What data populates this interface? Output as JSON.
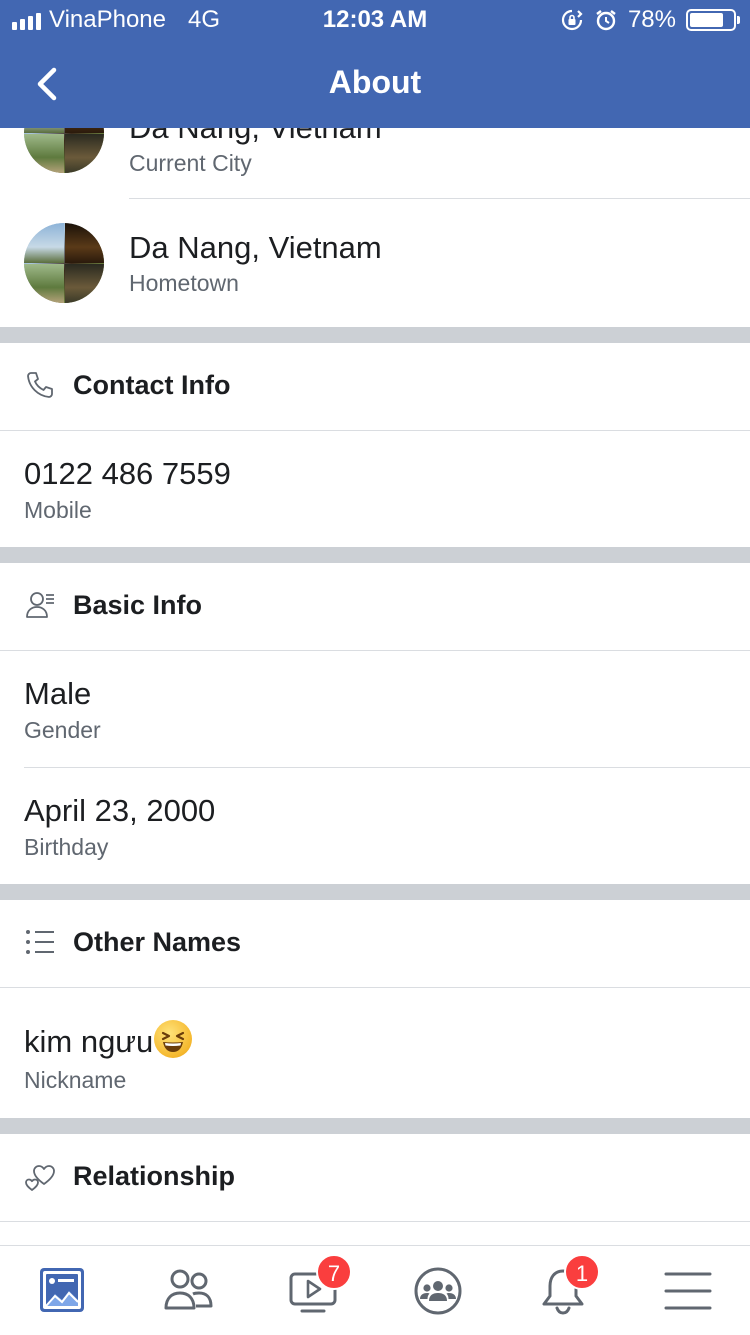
{
  "status_bar": {
    "carrier": "VinaPhone",
    "network": "4G",
    "time": "12:03 AM",
    "battery": "78%",
    "battery_level": 0.78
  },
  "nav": {
    "title": "About",
    "back_icon": "chevron-left-icon"
  },
  "places": [
    {
      "title": "Da Nang, Vietnam",
      "subtitle": "Current City"
    },
    {
      "title": "Da Nang, Vietnam",
      "subtitle": "Hometown"
    }
  ],
  "sections": {
    "contact": {
      "title": "Contact Info",
      "icon": "phone-icon",
      "rows": [
        {
          "value": "0122 486 7559",
          "label": "Mobile"
        }
      ]
    },
    "basic": {
      "title": "Basic Info",
      "icon": "person-list-icon",
      "rows": [
        {
          "value": "Male",
          "label": "Gender"
        },
        {
          "value": "April 23, 2000",
          "label": "Birthday"
        }
      ]
    },
    "other_names": {
      "title": "Other Names",
      "icon": "list-icon",
      "rows": [
        {
          "value": "kim ngưu",
          "label": "Nickname",
          "emoji": "grinning-squinting-face-icon"
        }
      ]
    },
    "relationship": {
      "title": "Relationship",
      "icon": "hearts-icon"
    }
  },
  "tabbar": {
    "items": [
      {
        "name": "news-feed",
        "icon": "news-feed-icon",
        "active": true
      },
      {
        "name": "friends",
        "icon": "friends-icon"
      },
      {
        "name": "watch",
        "icon": "watch-icon",
        "badge": "7"
      },
      {
        "name": "groups",
        "icon": "groups-icon"
      },
      {
        "name": "notifications",
        "icon": "bell-icon",
        "badge": "1"
      },
      {
        "name": "menu",
        "icon": "menu-icon"
      }
    ]
  },
  "colors": {
    "brand": "#4267b2",
    "badge": "#fa3e3e",
    "section_gap": "#ccd0d5",
    "secondary_text": "#606770"
  }
}
